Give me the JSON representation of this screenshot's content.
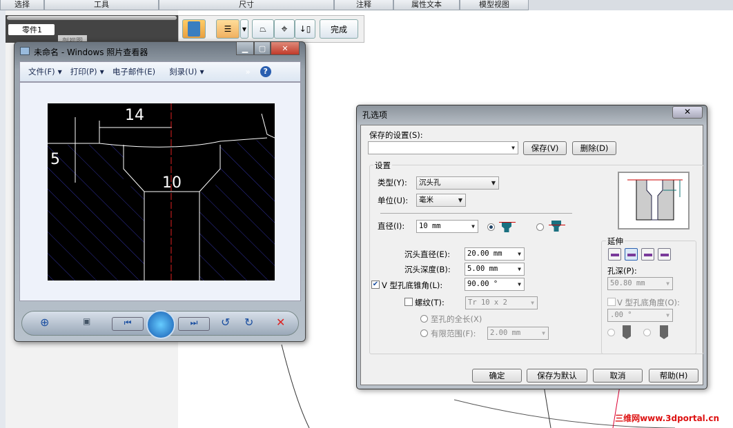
{
  "tabs": [
    "选择",
    "工具",
    "尺寸",
    "注释",
    "属性文本",
    "模型视图"
  ],
  "tree": {
    "part": "零件1",
    "section": "剖视图"
  },
  "toolbar": {
    "finish": "完成"
  },
  "viewer": {
    "title": "未命名 - Windows 照片查看器",
    "menu": [
      "文件(F)",
      "打印(P)",
      "电子邮件(E)",
      "刻录(U)"
    ],
    "drawing": {
      "dim_top": "14",
      "dim_left": "5",
      "dim_mid": "10"
    }
  },
  "dialog": {
    "title": "孔选项",
    "saved_settings_label": "保存的设置(S):",
    "saved_settings_value": "",
    "save": "保存(V)",
    "delete": "删除(D)",
    "settings_group": "设置",
    "type_label": "类型(Y):",
    "type_value": "沉头孔",
    "unit_label": "单位(U):",
    "unit_value": "毫米",
    "diameter_label": "直径(I):",
    "diameter_value": "10 mm",
    "diameter_mode_selected": "first",
    "cb_diameter_label": "沉头直径(E):",
    "cb_diameter_value": "20.00 mm",
    "cb_depth_label": "沉头深度(B):",
    "cb_depth_value": "5.00 mm",
    "v_angle_checked": true,
    "v_angle_label": "V 型孔底锥角(L):",
    "v_angle_value": "90.00 °",
    "thread_checked": false,
    "thread_label": "螺纹(T):",
    "thread_value": "Tr 10 x 2",
    "full_length": "至孔的全长(X)",
    "finite": "有限范围(F):",
    "finite_value": "2.00 mm",
    "extent_group": "延伸",
    "hole_depth_label": "孔深(P):",
    "hole_depth_value": "50.80 mm",
    "v_bottom_checked": false,
    "v_bottom_label": "V 型孔底角度(O):",
    "v_bottom_value": ".00 °",
    "ok": "确定",
    "save_default": "保存为默认",
    "cancel": "取消",
    "help": "帮助(H)"
  },
  "watermark": "三维网www.3dportal.cn"
}
